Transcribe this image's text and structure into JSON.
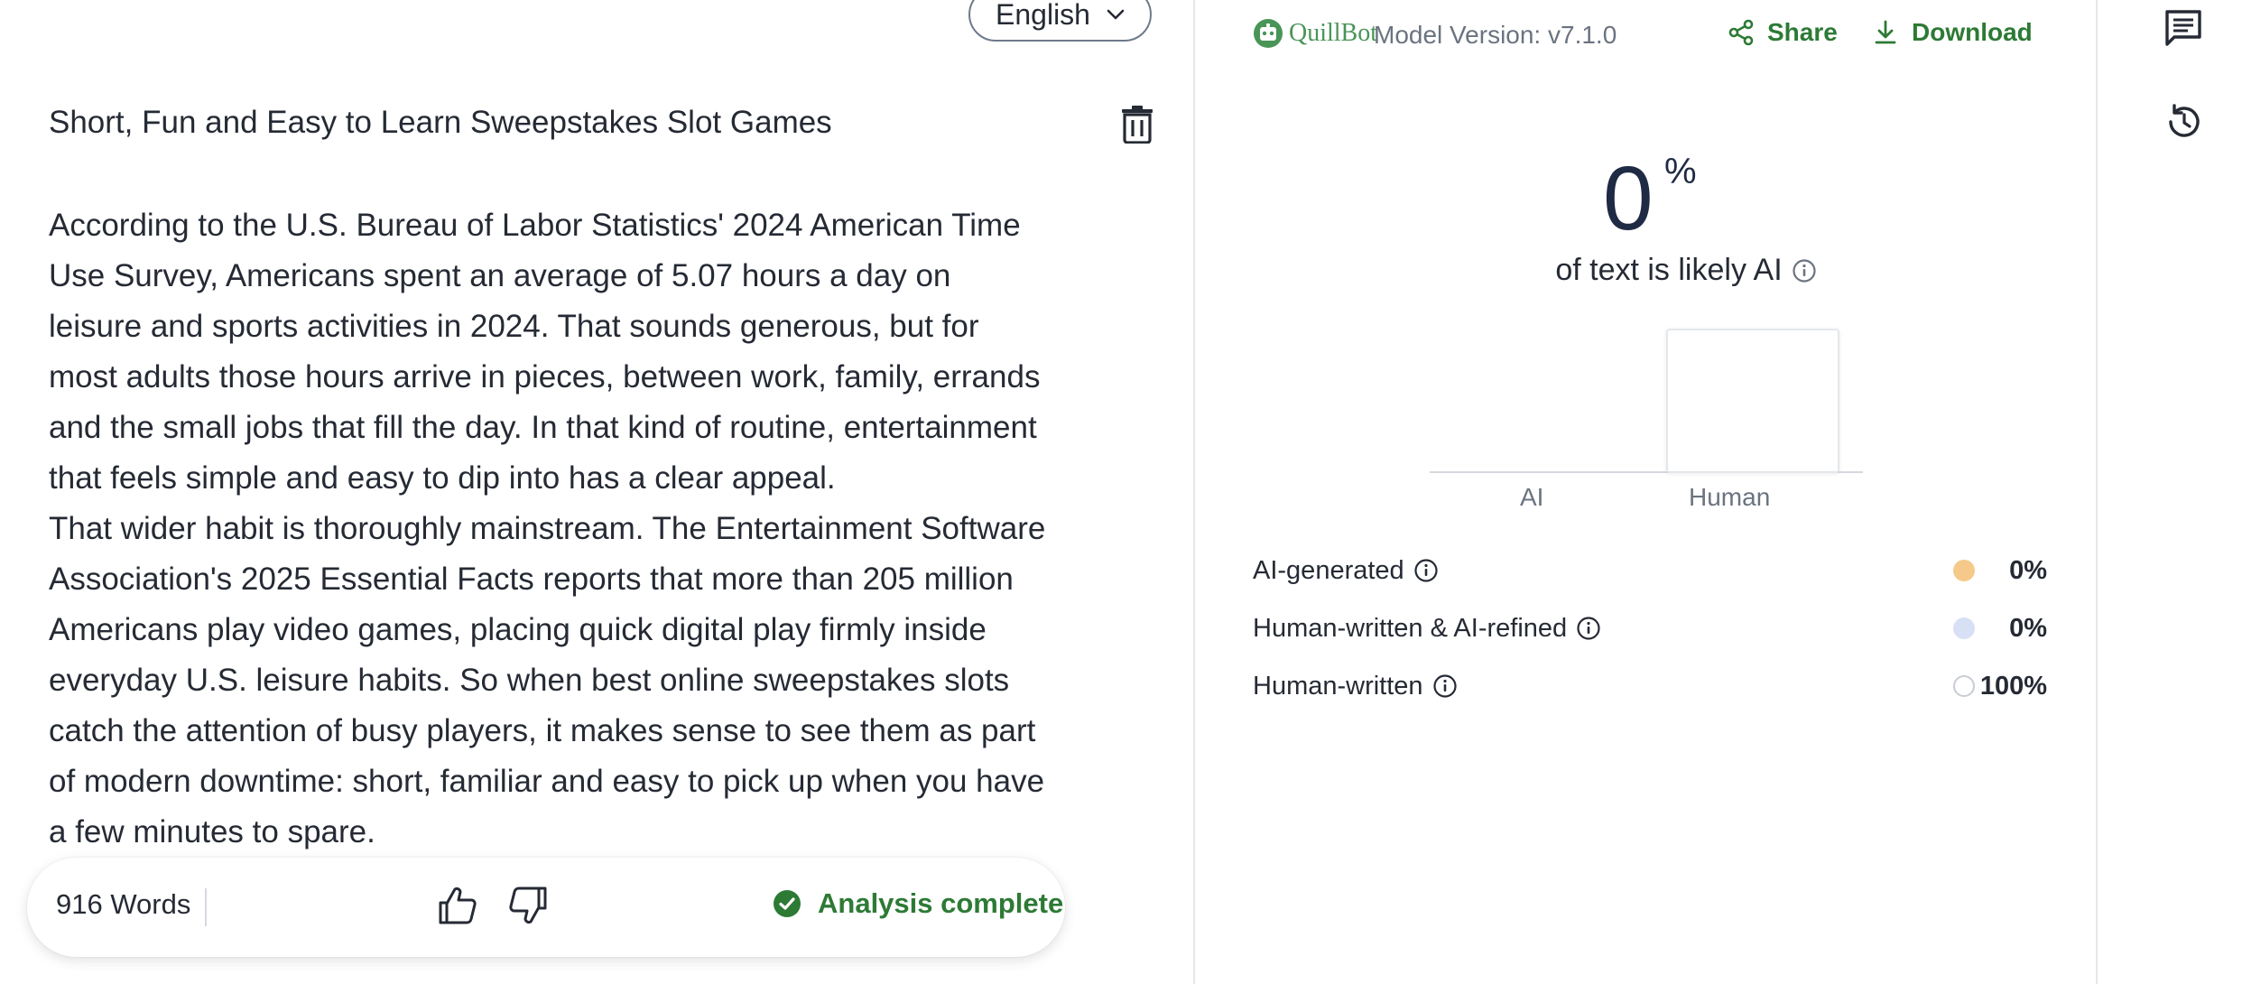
{
  "editor": {
    "language": "English",
    "title": "Short, Fun and Easy to Learn Sweepstakes Slot Games",
    "paragraphs": [
      "According to the U.S. Bureau of Labor Statistics' 2024 American Time Use Survey, Americans spent an average of 5.07 hours a day on leisure and sports activities in 2024. That sounds generous, but for most adults those hours arrive in pieces, between work, family, errands and the small jobs that fill the day. In that kind of routine, entertainment that feels simple and easy to dip into has a clear appeal.",
      "That wider habit is thoroughly mainstream. The Entertainment Software Association's 2025 Essential Facts reports that more than 205 million Americans play video games, placing quick digital play firmly inside everyday U.S. leisure habits. So when best online sweepstakes slots catch the attention of busy players, it makes sense to see them as part of modern downtime: short, familiar and easy to pick up when you have a few minutes to spare."
    ],
    "word_count": "916 Words",
    "analysis_status": "Analysis complete"
  },
  "results": {
    "brand": "QuillBot",
    "model_version": "Model Version: v7.1.0",
    "share_label": "Share",
    "download_label": "Download",
    "ai_percent": "0",
    "percent_sign": "%",
    "likely_text": "of text is likely AI",
    "chart": {
      "categories": [
        "AI",
        "Human"
      ],
      "values": [
        0,
        100
      ]
    },
    "legend": [
      {
        "label": "AI-generated",
        "value": "0%",
        "color": "#f5c98a"
      },
      {
        "label": "Human-written & AI-refined",
        "value": "0%",
        "color": "#d7e0f5"
      },
      {
        "label": "Human-written",
        "value": "100%",
        "color": "#ffffff"
      }
    ]
  },
  "colors": {
    "accent_green": "#2d7a35",
    "brand_green": "#499557",
    "text_dark": "#252a34"
  },
  "icons": {
    "trash": "trash-icon",
    "thumb_up": "thumb-up-icon",
    "thumb_down": "thumb-down-icon",
    "check": "check-circle-icon",
    "share": "share-icon",
    "download": "download-icon",
    "info": "info-icon",
    "comments": "comment-icon",
    "history": "history-icon"
  }
}
